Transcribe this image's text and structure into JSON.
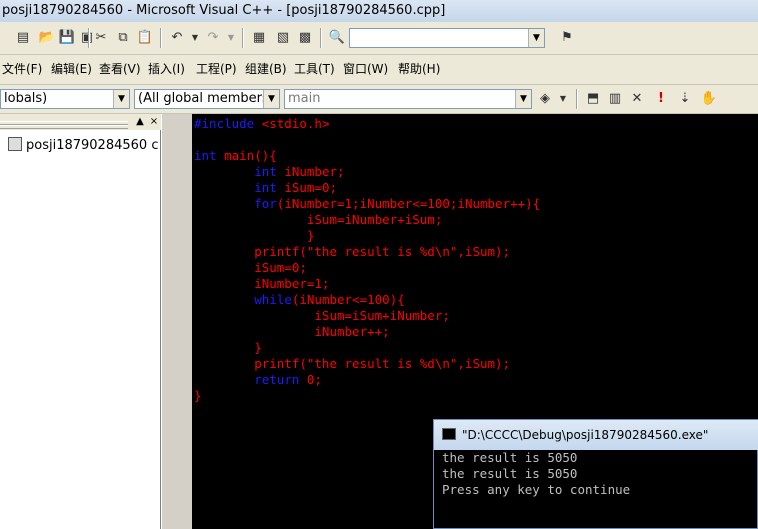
{
  "window": {
    "title": "posji18790284560 - Microsoft Visual C++ - [posji18790284560.cpp]"
  },
  "menu": [
    {
      "label": "文件(F)"
    },
    {
      "label": "编辑(E)"
    },
    {
      "label": "查看(V)"
    },
    {
      "label": "插入(I)"
    },
    {
      "label": "工程(P)"
    },
    {
      "label": "组建(B)"
    },
    {
      "label": "工具(T)"
    },
    {
      "label": "窗口(W)"
    },
    {
      "label": "帮助(H)"
    }
  ],
  "wizard_bar": {
    "scope": "lobals)",
    "filter": "(All global members",
    "member": "main"
  },
  "workspace": {
    "item": "posji18790284560 c"
  },
  "editor": {
    "lines": [
      [
        {
          "t": "#include ",
          "c": "kw"
        },
        {
          "t": "<stdio.h>",
          "c": "tx"
        }
      ],
      [],
      [
        {
          "t": "int",
          "c": "kw"
        },
        {
          "t": " main(){",
          "c": "tx"
        }
      ],
      [
        {
          "t": "        ",
          "c": "tx"
        },
        {
          "t": "int",
          "c": "kw"
        },
        {
          "t": " iNumber;",
          "c": "tx"
        }
      ],
      [
        {
          "t": "        ",
          "c": "tx"
        },
        {
          "t": "int",
          "c": "kw"
        },
        {
          "t": " iSum=0;",
          "c": "tx"
        }
      ],
      [
        {
          "t": "        ",
          "c": "tx"
        },
        {
          "t": "for",
          "c": "kw"
        },
        {
          "t": "(iNumber=1;iNumber<=100;iNumber++){",
          "c": "tx"
        }
      ],
      [
        {
          "t": "               iSum=iNumber+iSum;",
          "c": "tx"
        }
      ],
      [
        {
          "t": "               }",
          "c": "tx"
        }
      ],
      [
        {
          "t": "        printf(\"the result is %d\\n\",iSum);",
          "c": "tx"
        }
      ],
      [
        {
          "t": "        iSum=0;",
          "c": "tx"
        }
      ],
      [
        {
          "t": "        iNumber=1;",
          "c": "tx"
        }
      ],
      [
        {
          "t": "        ",
          "c": "tx"
        },
        {
          "t": "while",
          "c": "kw"
        },
        {
          "t": "(iNumber<=100){",
          "c": "tx"
        }
      ],
      [
        {
          "t": "                iSum=iSum+iNumber;",
          "c": "tx"
        }
      ],
      [
        {
          "t": "                iNumber++;",
          "c": "tx"
        }
      ],
      [
        {
          "t": "        }",
          "c": "tx"
        }
      ],
      [
        {
          "t": "        printf(\"the result is %d\\n\",iSum);",
          "c": "tx"
        }
      ],
      [
        {
          "t": "        ",
          "c": "tx"
        },
        {
          "t": "return",
          "c": "kw"
        },
        {
          "t": " 0;",
          "c": "tx"
        }
      ],
      [
        {
          "t": "}",
          "c": "tx"
        }
      ]
    ]
  },
  "console": {
    "title": "\"D:\\CCCC\\Debug\\posji18790284560.exe\"",
    "output": [
      "the result is 5050",
      "the result is 5050",
      "Press any key to continue"
    ]
  },
  "colors": {
    "keyword": "#1b1bff",
    "text": "#ff0000",
    "editor_bg": "#000000"
  }
}
